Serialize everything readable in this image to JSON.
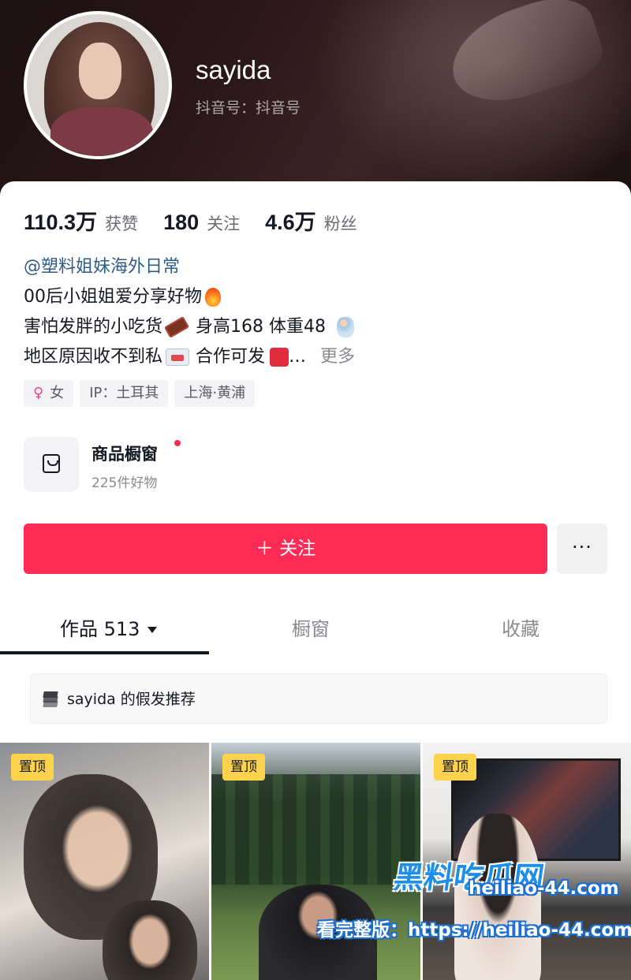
{
  "profile": {
    "name": "sayida",
    "douyin_id": "抖音号：抖音号"
  },
  "stats": [
    {
      "value": "110.3万",
      "label": "获赞"
    },
    {
      "value": "180",
      "label": "关注"
    },
    {
      "value": "4.6万",
      "label": "粉丝"
    }
  ],
  "bio": {
    "mention": "@塑料姐妹海外日常",
    "line1": "00后小姐姐爱分享好物",
    "line2_a": "害怕发胖的小吃货",
    "line2_b": "身高168 体重48",
    "line3_a": "地区原因收不到私",
    "line3_b": "合作可发",
    "ellipsis": "…",
    "more": "更多"
  },
  "tags": {
    "gender_icon": "♀",
    "gender": "女",
    "ip": "IP：土耳其",
    "location": "上海·黄浦"
  },
  "shop": {
    "title": "商品橱窗",
    "subtitle": "225件好物"
  },
  "actions": {
    "follow": "＋ 关注",
    "more": "···"
  },
  "tabs": [
    {
      "label": "作品 513"
    },
    {
      "label": "橱窗"
    },
    {
      "label": "收藏"
    }
  ],
  "collection": {
    "label": "sayida 的假发推荐"
  },
  "posts": [
    {
      "badge": "置顶"
    },
    {
      "badge": "置顶"
    },
    {
      "badge": "置顶"
    }
  ],
  "watermark": {
    "brand": "黑料吃瓜网",
    "domain": "heiliao-44.com",
    "line": "看完整版：https://heiliao-44.com"
  },
  "colors": {
    "accent": "#fe2c55",
    "mention": "#2f5b87",
    "pin_badge": "#fdd34d"
  }
}
